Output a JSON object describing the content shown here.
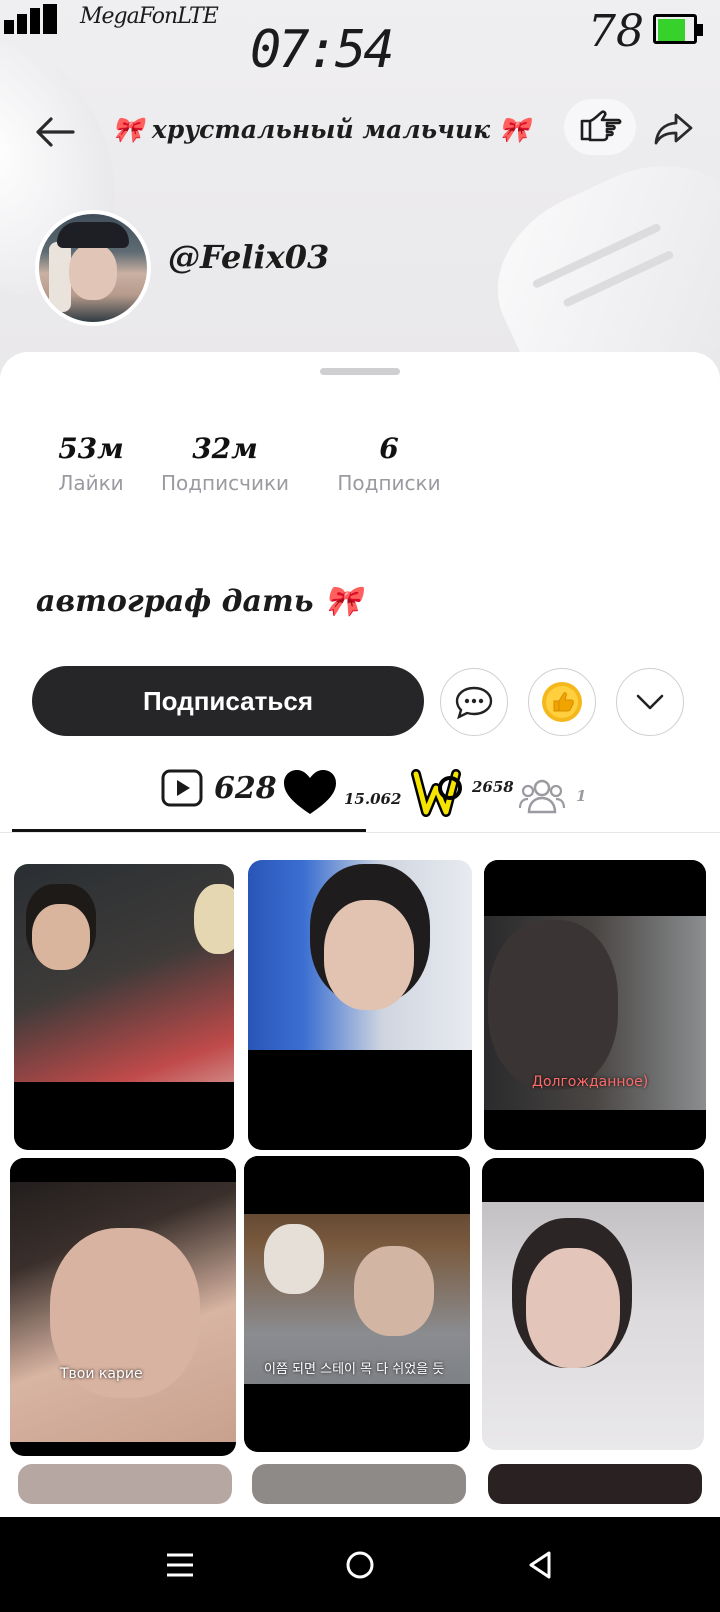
{
  "status_bar": {
    "carrier": "MegaFonLTE",
    "time": "07:54",
    "battery_level": "78",
    "battery_fraction": 0.78,
    "battery_color": "#36d12a"
  },
  "topbar": {
    "back_icon": "arrow-left-icon",
    "title": "🎀 хрустальный мальчик 🎀",
    "point_icon": "pointing-hand-icon",
    "share_icon": "share-arrow-icon"
  },
  "profile": {
    "username": "@Felix03",
    "stats": [
      {
        "value": "53м",
        "label": "Лайки"
      },
      {
        "value": "32м",
        "label": "Подписчики"
      },
      {
        "value": "6",
        "label": "Подписки"
      }
    ],
    "bio": "автограф дать 🎀",
    "follow_label": "Подписаться"
  },
  "tabs": {
    "videos_count": "628",
    "likes_count": "15.062",
    "sticker_count": "2658",
    "groups_count": "1"
  },
  "videos": {
    "captions": [
      "Долгожданное)",
      "Твои карие",
      "이쯤 되면 스테이 목 다 쉬었을 듯"
    ]
  },
  "navbar": {
    "items": [
      "menu-icon",
      "home-circle-icon",
      "back-triangle-icon"
    ]
  }
}
